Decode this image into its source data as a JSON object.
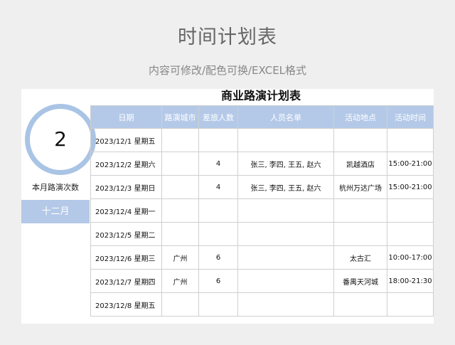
{
  "page": {
    "title": "时间计划表",
    "subtitle": "内容可修改/配色可换/EXCEL格式"
  },
  "sheet": {
    "title": "商业路演计划表",
    "count": "2",
    "count_label": "本月路演次数",
    "month": "十二月",
    "columns": [
      "日期",
      "路演城市",
      "差旅人数",
      "人员名单",
      "活动地点",
      "活动时间"
    ],
    "rows": [
      [
        "2023/12/1  星期五",
        "",
        "",
        "",
        "",
        ""
      ],
      [
        "2023/12/2  星期六",
        "",
        "4",
        "张三, 李四, 王五, 赵六",
        "凯越酒店",
        "15:00-21:00"
      ],
      [
        "2023/12/3  星期日",
        "",
        "4",
        "张三, 李四, 王五, 赵六",
        "杭州万达广场",
        "15:00-21:00"
      ],
      [
        "2023/12/4  星期一",
        "",
        "",
        "",
        "",
        ""
      ],
      [
        "2023/12/5  星期二",
        "",
        "",
        "",
        "",
        ""
      ],
      [
        "2023/12/6  星期三",
        "广州",
        "6",
        "",
        "太古汇",
        "10:00-17:00"
      ],
      [
        "2023/12/7  星期四",
        "广州",
        "6",
        "",
        "番禺天河城",
        "18:00-21:30"
      ],
      [
        "2023/12/8  星期五",
        "",
        "",
        "",
        "",
        ""
      ]
    ]
  }
}
